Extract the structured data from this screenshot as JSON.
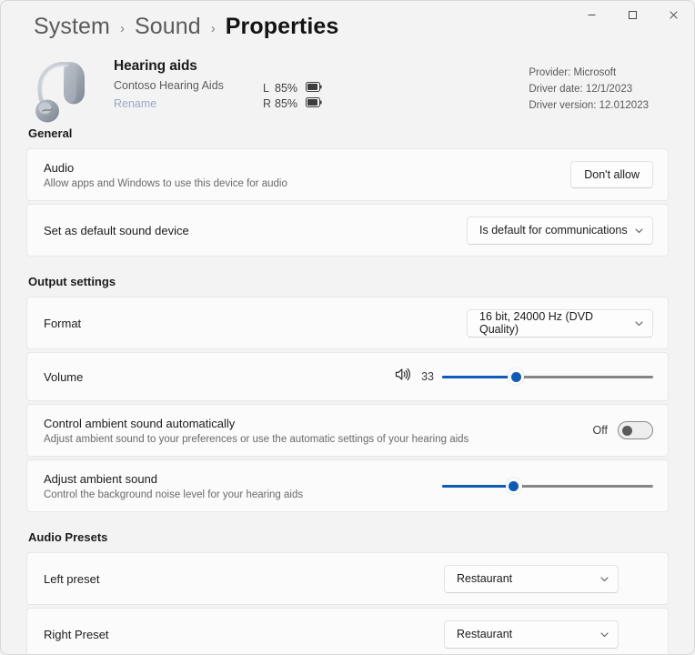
{
  "window": {
    "caption_buttons": [
      {
        "name": "minimize",
        "glyph": "minimize-icon"
      },
      {
        "name": "maximize",
        "glyph": "maximize-icon"
      },
      {
        "name": "close",
        "glyph": "close-icon"
      }
    ]
  },
  "breadcrumb": {
    "items": [
      {
        "label": "System",
        "current": false
      },
      {
        "label": "Sound",
        "current": false
      },
      {
        "label": "Properties",
        "current": true
      }
    ],
    "separator": "›"
  },
  "device": {
    "icon": "hearing-aid-icon",
    "title": "Hearing aids",
    "subtitle": "Contoso Hearing Aids",
    "rename_link": "Rename",
    "battery": [
      {
        "side": "L",
        "percent": "85%",
        "level": 85
      },
      {
        "side": "R",
        "percent": "85%",
        "level": 85
      }
    ],
    "driver": {
      "provider": "Provider: Microsoft",
      "date": "Driver date: 12/1/2023",
      "version": "Driver version: 12.012023"
    }
  },
  "sections": {
    "general": {
      "title": "General",
      "audio": {
        "label": "Audio",
        "description": "Allow apps and Windows to use this device for audio",
        "button_label": "Don't allow"
      },
      "default_device": {
        "label": "Set as default sound device",
        "value": "Is default for communications"
      }
    },
    "output": {
      "title": "Output settings",
      "format": {
        "label": "Format",
        "value": "16 bit, 24000 Hz (DVD Quality)"
      },
      "volume": {
        "label": "Volume",
        "icon": "speaker-volume-icon",
        "value": "33",
        "percent": 35
      },
      "ambient_auto": {
        "label": "Control ambient sound automatically",
        "description": "Adjust ambient sound to your preferences or use the automatic settings of your hearing aids",
        "state_label": "Off",
        "state_on": false
      },
      "ambient_adjust": {
        "label": "Adjust ambient sound",
        "description": "Control the background noise level for your hearing aids",
        "percent": 34
      }
    },
    "presets": {
      "title": "Audio Presets",
      "left": {
        "label": "Left preset",
        "value": "Restaurant"
      },
      "right": {
        "label": "Right Preset",
        "value": "Restaurant"
      }
    }
  },
  "colors": {
    "accent": "#0f5bb5",
    "page_background": "#f3f3f3",
    "card_background": "#fbfbfb",
    "link": "#9aa7c7"
  }
}
